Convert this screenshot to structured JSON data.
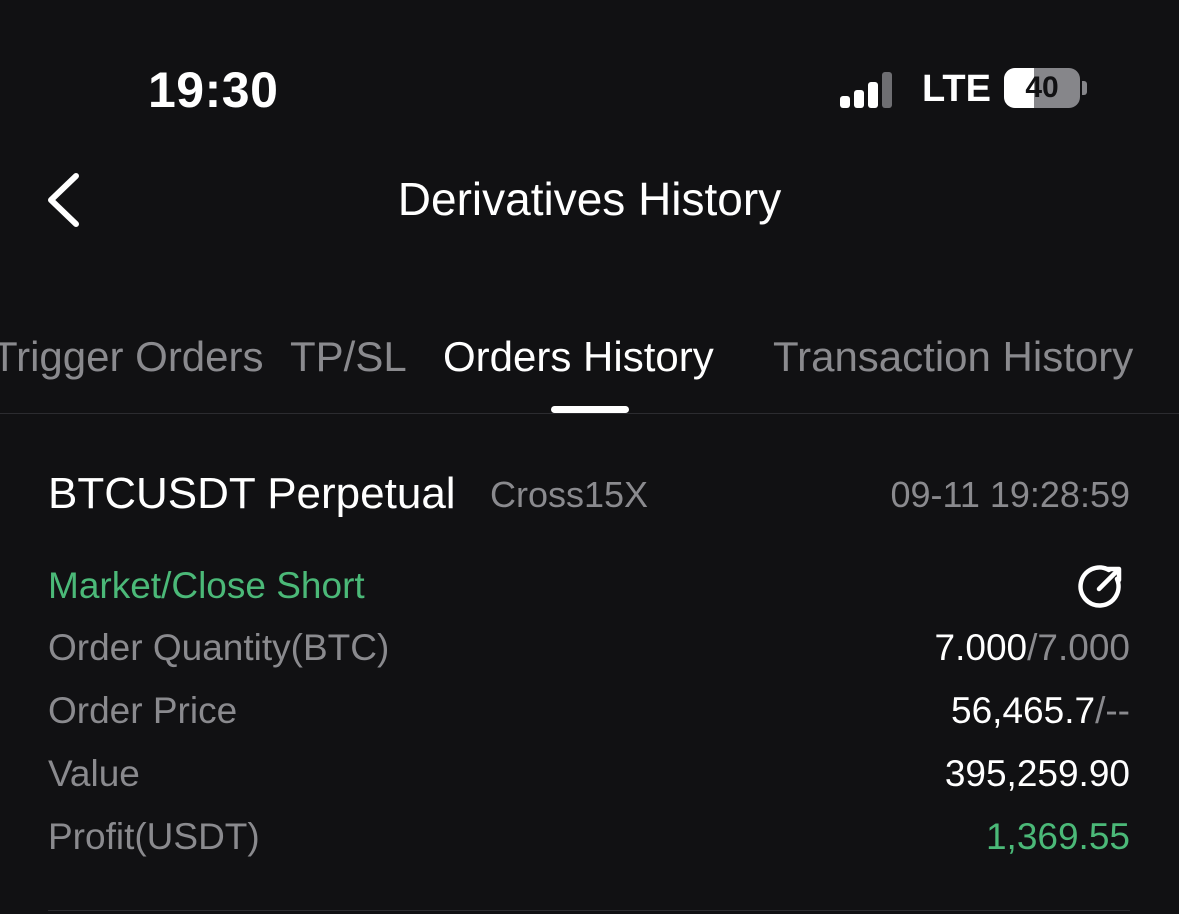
{
  "status_bar": {
    "time": "19:30",
    "network": "LTE",
    "battery_level": "40",
    "battery_fraction": 0.4,
    "signal_bars_filled": 3,
    "signal_bars_total": 4
  },
  "header": {
    "title": "Derivatives History",
    "back_icon": "chevron-left-icon"
  },
  "tabs": [
    {
      "label": "Trigger Orders",
      "active": false
    },
    {
      "label": "TP/SL",
      "active": false
    },
    {
      "label": "Orders History",
      "active": true
    },
    {
      "label": "Transaction History",
      "active": false
    }
  ],
  "order": {
    "symbol": "BTCUSDT Perpetual",
    "leverage": "Cross15X",
    "time": "09-11 19:28:59",
    "type": "Market/Close Short",
    "share_icon": "share-arrow-icon",
    "rows": [
      {
        "label": "Order Quantity(BTC)",
        "value": "7.000",
        "secondary": "/7.000"
      },
      {
        "label": "Order Price",
        "value": "56,465.7",
        "secondary": "/--"
      },
      {
        "label": "Value",
        "value": "395,259.90",
        "secondary": ""
      },
      {
        "label": "Profit(USDT)",
        "value": "1,369.55",
        "secondary": ""
      }
    ]
  },
  "colors": {
    "background": "#111113",
    "primary_text": "#ffffff",
    "secondary_text": "#8a8a8e",
    "positive": "#4bb978"
  }
}
